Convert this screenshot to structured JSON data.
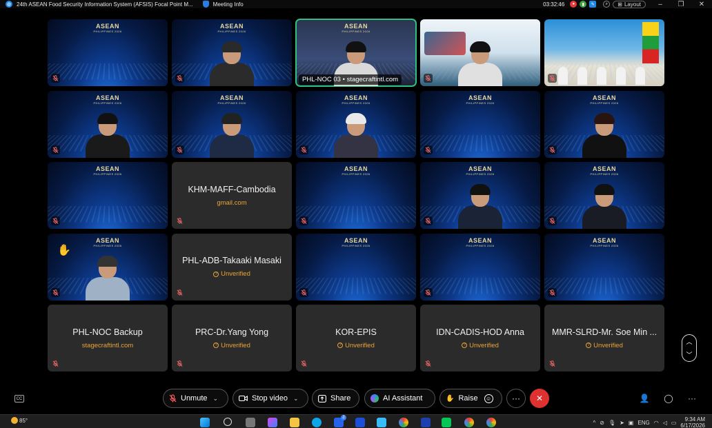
{
  "window": {
    "title": "24th ASEAN Food Security Information System (AFSIS) Focal Point M...",
    "meeting_info": "Meeting Info",
    "elapsed": "03:32:46",
    "layout_label": "Layout"
  },
  "banner": {
    "title": "ASEAN",
    "subtitle": "PHILIPPINES 2026"
  },
  "tiles": [
    {
      "kind": "video",
      "name": "",
      "person": false
    },
    {
      "kind": "video",
      "name": "",
      "person": true,
      "hair": "#2a2a2a",
      "shirt": "#2b2b2b"
    },
    {
      "kind": "video",
      "name": "PHL-NOC 03 • stagecraftintl.com",
      "person": true,
      "active": true,
      "hair": "#111",
      "shirt": "#d9d9d9"
    },
    {
      "kind": "video",
      "name": "",
      "person": true,
      "hair": "#111",
      "shirt": "#e0e0e0",
      "scene": "VIRTUAL BACKGROUND"
    },
    {
      "kind": "video",
      "name": "",
      "person": false,
      "scene": "room"
    },
    {
      "kind": "video",
      "name": "",
      "person": true,
      "hair": "#111",
      "shirt": "#1a1a1a"
    },
    {
      "kind": "video",
      "name": "",
      "person": true,
      "hair": "#222",
      "shirt": "#1f2a44"
    },
    {
      "kind": "video",
      "name": "",
      "person": true,
      "hair": "#e9e9e9",
      "shirt": "#334"
    },
    {
      "kind": "video",
      "name": "",
      "person": false
    },
    {
      "kind": "video",
      "name": "",
      "person": true,
      "hair": "#2a1410",
      "shirt": "#111"
    },
    {
      "kind": "video",
      "name": "",
      "person": false
    },
    {
      "kind": "name",
      "name": "KHM-MAFF-Cambodia",
      "sub": "gmail.com",
      "unverified": false
    },
    {
      "kind": "video",
      "name": "",
      "person": false
    },
    {
      "kind": "video",
      "name": "",
      "person": true,
      "hair": "#111",
      "shirt": "#1b2436"
    },
    {
      "kind": "video",
      "name": "",
      "person": true,
      "hair": "#111",
      "shirt": "#1a1c25"
    },
    {
      "kind": "video",
      "name": "",
      "person": true,
      "hair": "#333",
      "shirt": "#9fb1c4",
      "hand": true
    },
    {
      "kind": "name",
      "name": "PHL-ADB-Takaaki Masaki",
      "sub": "Unverified",
      "unverified": true
    },
    {
      "kind": "video",
      "name": "",
      "person": false
    },
    {
      "kind": "video",
      "name": "",
      "person": false
    },
    {
      "kind": "video",
      "name": "",
      "person": false
    },
    {
      "kind": "name",
      "name": "PHL-NOC Backup",
      "sub": "stagecraftintl.com",
      "unverified": false
    },
    {
      "kind": "name",
      "name": "PRC-Dr.Yang Yong",
      "sub": "Unverified",
      "unverified": true
    },
    {
      "kind": "name",
      "name": "KOR-EPIS",
      "sub": "Unverified",
      "unverified": true
    },
    {
      "kind": "name",
      "name": "IDN-CADIS-HOD Anna",
      "sub": "Unverified",
      "unverified": true
    },
    {
      "kind": "name",
      "name": "MMR-SLRD-Mr. Soe Min ...",
      "sub": "Unverified",
      "unverified": true
    }
  ],
  "toolbar": {
    "unmute": "Unmute",
    "stop_video": "Stop video",
    "share": "Share",
    "ai_assistant": "AI Assistant",
    "raise": "Raise",
    "more": "···",
    "cc": "CC"
  },
  "taskbar": {
    "temperature": "85°",
    "language": "ENG",
    "time": "9:34 AM",
    "date": "6/17/2026",
    "badge_count": "2"
  }
}
